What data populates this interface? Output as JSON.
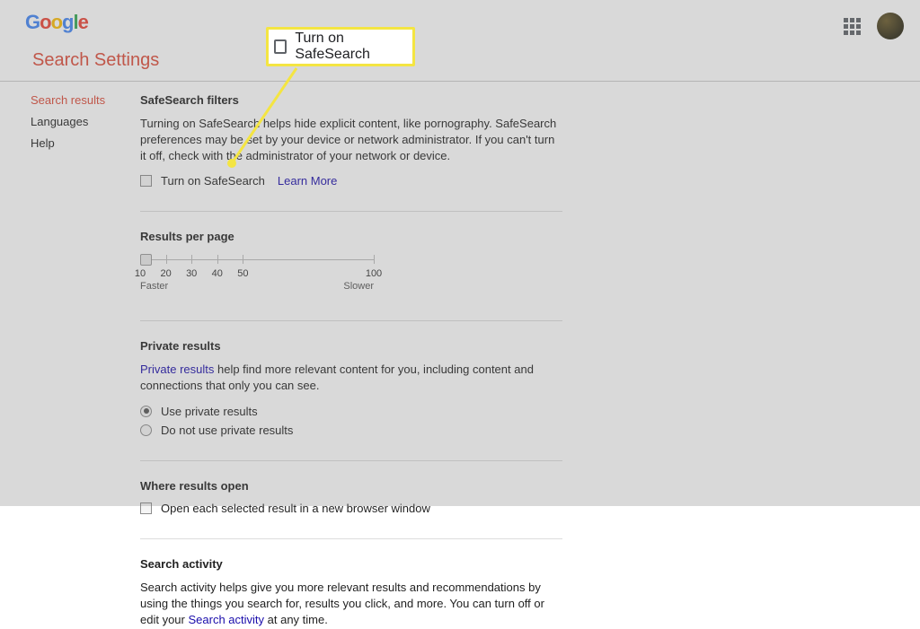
{
  "header": {
    "logo_chars": [
      "G",
      "o",
      "o",
      "g",
      "l",
      "e"
    ],
    "page_title": "Search Settings"
  },
  "sidebar": {
    "items": [
      {
        "label": "Search results",
        "active": true
      },
      {
        "label": "Languages",
        "active": false
      },
      {
        "label": "Help",
        "active": false
      }
    ]
  },
  "callout": {
    "label": "Turn on SafeSearch"
  },
  "safesearch": {
    "title": "SafeSearch filters",
    "desc": "Turning on SafeSearch helps hide explicit content, like pornography. SafeSearch preferences may be set by your device or network administrator. If you can't turn it off, check with the administrator of your network or device.",
    "checkbox_label": "Turn on SafeSearch",
    "learn_more": "Learn More"
  },
  "results_per_page": {
    "title": "Results per page",
    "ticks": [
      "10",
      "20",
      "30",
      "40",
      "50",
      "100"
    ],
    "positions_pct": [
      0,
      11,
      22,
      33,
      44,
      100
    ],
    "selected_index": 0,
    "faster": "Faster",
    "slower": "Slower"
  },
  "private_results": {
    "title": "Private results",
    "link_text": "Private results",
    "desc_tail": " help find more relevant content for you, including content and connections that only you can see.",
    "options": [
      {
        "label": "Use private results",
        "checked": true
      },
      {
        "label": "Do not use private results",
        "checked": false
      }
    ]
  },
  "where_results_open": {
    "title": "Where results open",
    "checkbox_label": "Open each selected result in a new browser window"
  },
  "search_activity": {
    "title": "Search activity",
    "desc_pre": "Search activity helps give you more relevant results and recommendations by using the things you search for, results you click, and more. You can turn off or edit your ",
    "link_text": "Search activity",
    "desc_post": " at any time."
  }
}
